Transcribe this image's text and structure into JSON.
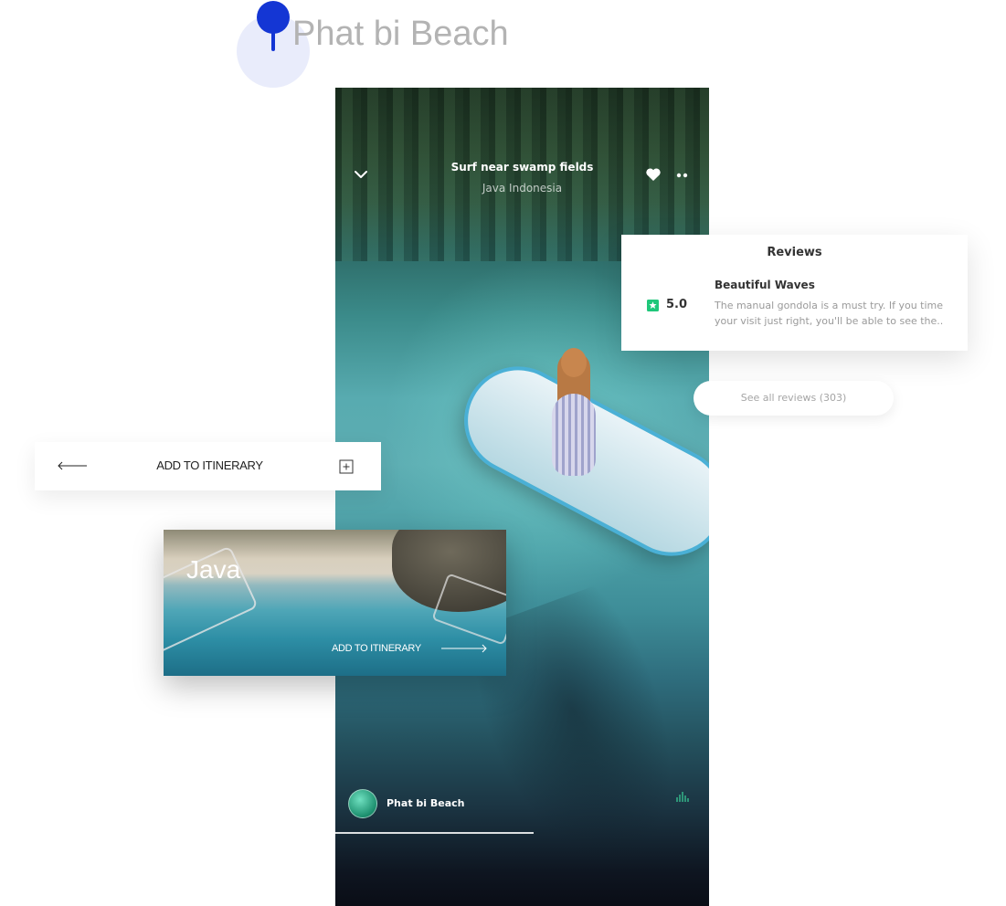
{
  "header": {
    "title": "Phat bi Beach",
    "pin_color": "#1436d4"
  },
  "phone": {
    "title": "Surf near swamp fields",
    "subtitle": "Java Indonesia",
    "footer_place": "Phat bi Beach",
    "icons": [
      "chevron-down-icon",
      "heart-icon",
      "more-icon",
      "audio-icon"
    ]
  },
  "reviews": {
    "heading": "Reviews",
    "rating": "5.0",
    "star_color": "#1fc77a",
    "review_title": "Beautiful Waves",
    "review_text": "The manual gondola is a must try. If you time your visit just right, you'll be able to see the..",
    "see_all": "See all reviews (303)"
  },
  "itinerary_bar": {
    "label": "ADD TO ITINERARY"
  },
  "java_card": {
    "title": "Java",
    "cta": "ADD TO ITINERARY"
  }
}
